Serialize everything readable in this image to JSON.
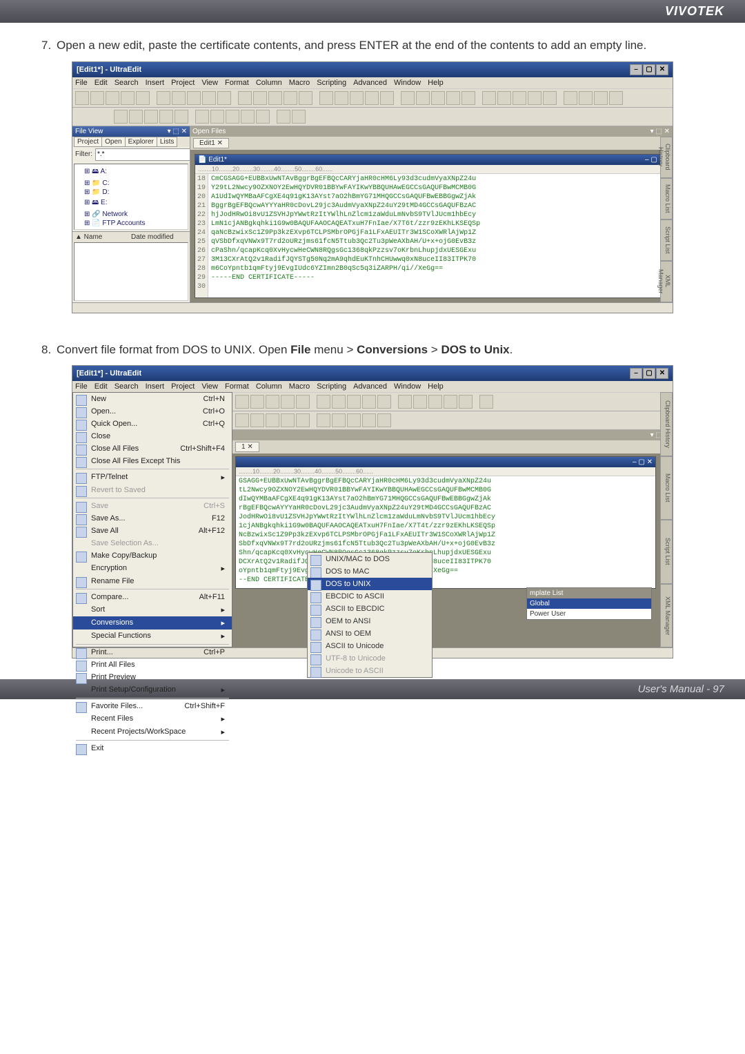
{
  "brand": "VIVOTEK",
  "footer": "User's Manual - 97",
  "step7": {
    "num": "7.",
    "text": "Open a new edit, paste the certificate contents, and press ENTER at the end of the contents to add an empty line."
  },
  "step8": {
    "num": "8.",
    "prefix": "Convert file format from DOS to UNIX. Open ",
    "b1": "File",
    "mid1": " menu > ",
    "b2": "Conversions",
    "mid2": " > ",
    "b3": "DOS to Unix",
    "suffix": "."
  },
  "app": {
    "title": "[Edit1*] - UltraEdit",
    "menus": [
      "File",
      "Edit",
      "Search",
      "Insert",
      "Project",
      "View",
      "Format",
      "Column",
      "Macro",
      "Scripting",
      "Advanced",
      "Window",
      "Help"
    ],
    "fileViewHeader": "File View",
    "pinLabel": "▾ ⬚ ✕",
    "openFilesHeader": "Open Files",
    "openFilesPin": "▾ ⬚ ✕",
    "explorerTabs": [
      "Project",
      "Open",
      "Explorer",
      "Lists"
    ],
    "filterLabel": "Filter:",
    "filterValue": "*.*",
    "tree": [
      "⊞ 🖴 A:",
      "⊞ 📁 C:",
      "⊞ 📁 D:",
      "⊞ 🖴 E:",
      "⊞ 🔗 Network",
      "⊞ 📄 FTP Accounts"
    ],
    "listCols": [
      "▲ Name",
      "Date modified"
    ],
    "docTab": "Edit1  ✕",
    "docTitle": "Edit1*",
    "docWinBtns": "– ▢ ✕",
    "ruler": "........10........20........30........40........50........60......",
    "gutter": "18\n19\n20\n21\n22\n23\n24\n25\n26\n27\n28\n29\n30",
    "code": "CmCGSAGG+EUBBxUwNTAvBggrBgEFBQcCARYjaHR0cHM6Ly93d3cudmVyaXNpZ24u\nY29tL2Nwcy9OZXNOY2EwHQYDVR01BBYwFAYIKwYBBQUHAwEGCCsGAQUFBwMCMB0G\nA1UdIwQYMBaAFCgXE4q91gK13AYst7aO2hBmYG71MHQGCCsGAQUFBwEBBGgwZjAk\nBggrBgEFBQcwAYYYaHR0cDovL29jc3AudmVyaXNpZ24uY29tMD4GCCsGAQUFBzAC\nhjJodHRwOi8vU1ZSVHJpYWwtRzItYWlhLnZlcm1zaWduLmNvbS9TVlJUcm1hbEcy\nLmN1cjANBgkqhki1G9w0BAQUFAAOCAQEATxuH7FnIae/X7T6t/zzr9zEKhLKSEQSp\nqaNcBzwixSc1Z9Pp3kzEXvp6TCLPSMbrOPGjFa1LFxAEUITr3W1SCoXWRlAjWp1Z\nqVSbDfxqVNWx9T7rd2oURzjms61fcN5Ttub3Qc2Tu3pWeAXbAH/U+x+ojG0EvB3z\ncPaShn/qcapKcq0XvHycwHeCWN8RQgsGc1368qkPzzsv7oKrbnLhupjdxUESGExu\n3M13CXrAtQ2v1RadifJQYSTg50Nq2mA9qhdEuKTnhCHUwwq0xN8uceII83ITPK70\nm6CoYpntb1qmFtyj9EvgIUdc6YZImn2B0qSc5q3iZARPH/qi//XeGg==\n-----END CERTIFICATE-----\n",
    "sideTabs": [
      "Clipboard History",
      "Macro List",
      "Script List",
      "XML Manager"
    ]
  },
  "app2": {
    "title": "[Edit1*] - UltraEdit",
    "docTab": "1  ✕",
    "ruler": "........10........20........30........40........50........60......",
    "code2": "GSAGG+EUBBxUwNTAvBggrBgEFBQcCARYjaHR0cHM6Ly93d3cudmVyaXNpZ24u\ntL2Nwcy9OZXNOY2EwHQYDVR01BBYwFAYIKwYBBQUHAwEGCCsGAQUFBwMCMB0G\ndIwQYMBaAFCgXE4q91gK13AYst7aO2hBmYG71MHQGCCsGAQUFBwEBBGgwZjAk\nrBgEFBQcwAYYYaHR0cDovL29jc3AudmVyaXNpZ24uY29tMD4GCCsGAQUFBzAC\nJodHRwOi8vU1ZSVHJpYWwtRzItYWlhLnZlcm1zaWduLmNvbS9TVlJUcm1hbEcy\n1cjANBgkqhki1G9w0BAQUFAAOCAQEATxuH7FnIae/X7T4t/zzr9zEKhLKSEQSp\nNcBzwixSc1Z9Pp3kzEXvp6TCLPSMbrOPGjFa1LFxAEUITr3W1SCoXWRlAjWp1Z\nSbDfxqVNWx9T7rd2oURzjms61fcN5Ttub3Qc2Tu3pWeAXbAH/U+x+ojG0EvB3z\nShn/qcapKcq0XvHycwHeCWN8RQgsGc1368qkPzzsv7oKrbnLhupjdxUESGExu\nDCXrAtQ2v1RadifJQYSTg50Nq2mA9qhdEuKTnhCHUwwq0xN8uceII83ITPK70\noYpntb1qmFtyj9EvgIUdc6YZImn2B0qSc5q3iZARPH/qi//XeGg==\n--END CERTIFICATE-----",
    "fileMenu": [
      {
        "label": "New",
        "sc": "Ctrl+N",
        "icon": true
      },
      {
        "label": "Open...",
        "sc": "Ctrl+O",
        "icon": true
      },
      {
        "label": "Quick Open...",
        "sc": "Ctrl+Q",
        "icon": true
      },
      {
        "label": "Close",
        "sc": "",
        "icon": true
      },
      {
        "label": "Close All Files",
        "sc": "Ctrl+Shift+F4",
        "icon": true
      },
      {
        "label": "Close All Files Except This",
        "sc": "",
        "icon": true
      },
      {
        "sep": true
      },
      {
        "label": "FTP/Telnet",
        "sc": "▸",
        "icon": true
      },
      {
        "label": "Revert to Saved",
        "sc": "",
        "icon": true,
        "disabled": true
      },
      {
        "sep": true
      },
      {
        "label": "Save",
        "sc": "Ctrl+S",
        "icon": true,
        "disabled": true
      },
      {
        "label": "Save As...",
        "sc": "F12",
        "icon": true
      },
      {
        "label": "Save All",
        "sc": "Alt+F12",
        "icon": true
      },
      {
        "label": "Save Selection As...",
        "sc": "",
        "icon": false,
        "disabled": true
      },
      {
        "label": "Make Copy/Backup",
        "sc": "",
        "icon": true
      },
      {
        "label": "Encryption",
        "sc": "▸",
        "icon": false
      },
      {
        "label": "Rename File",
        "sc": "",
        "icon": true
      },
      {
        "sep": true
      },
      {
        "label": "Compare...",
        "sc": "Alt+F11",
        "icon": true
      },
      {
        "label": "Sort",
        "sc": "▸",
        "icon": false
      },
      {
        "label": "Conversions",
        "sc": "▸",
        "icon": false,
        "hover": true
      },
      {
        "label": "Special Functions",
        "sc": "▸",
        "icon": false
      },
      {
        "sep": true
      },
      {
        "label": "Print...",
        "sc": "Ctrl+P",
        "icon": true
      },
      {
        "label": "Print All Files",
        "sc": "",
        "icon": true
      },
      {
        "label": "Print Preview",
        "sc": "",
        "icon": true
      },
      {
        "label": "Print Setup/Configuration",
        "sc": "▸",
        "icon": false
      },
      {
        "sep": true
      },
      {
        "label": "Favorite Files...",
        "sc": "Ctrl+Shift+F",
        "icon": true
      },
      {
        "label": "Recent Files",
        "sc": "▸",
        "icon": false
      },
      {
        "label": "Recent Projects/WorkSpace",
        "sc": "▸",
        "icon": false
      },
      {
        "sep": true
      },
      {
        "label": "Exit",
        "sc": "",
        "icon": true
      }
    ],
    "convMenu": [
      {
        "label": "UNIX/MAC to DOS",
        "icon": true
      },
      {
        "label": "DOS to MAC",
        "icon": true
      },
      {
        "label": "DOS to UNIX",
        "icon": true,
        "hover": true
      },
      {
        "sep": true
      },
      {
        "label": "EBCDIC to ASCII",
        "icon": true
      },
      {
        "label": "ASCII to EBCDIC",
        "icon": true
      },
      {
        "sep": true
      },
      {
        "label": "OEM to ANSI",
        "icon": true
      },
      {
        "label": "ANSI to OEM",
        "icon": true
      },
      {
        "sep": true
      },
      {
        "label": "ASCII to Unicode",
        "icon": true
      },
      {
        "label": "UTF-8 to Unicode",
        "icon": true,
        "disabled": true
      },
      {
        "sep": true
      },
      {
        "label": "Unicode to ASCII",
        "icon": true,
        "disabled": true
      }
    ],
    "tmplHeader": "mplate List",
    "tmplRows": [
      "Global",
      "Power User"
    ]
  }
}
